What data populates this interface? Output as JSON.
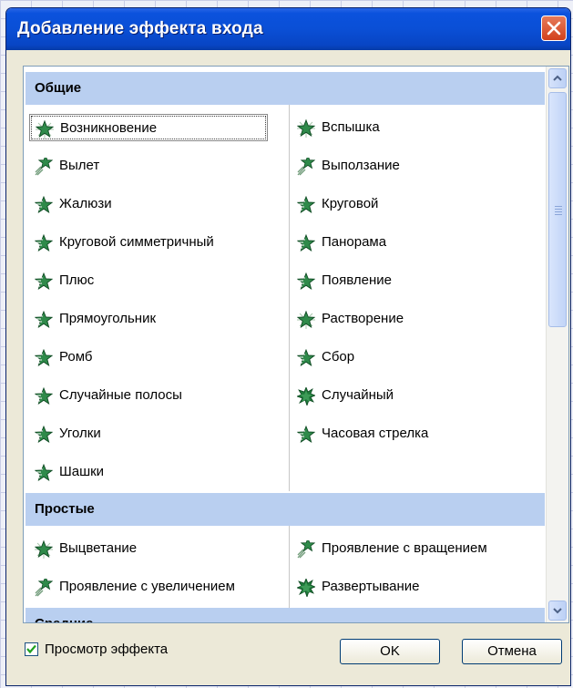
{
  "dialog": {
    "title": "Добавление эффекта входа",
    "close_label": "×"
  },
  "groups": [
    {
      "name": "Общие",
      "items_left": [
        {
          "label": "Возникновение",
          "icon": "star-burst-icon",
          "selected": true
        },
        {
          "label": "Вылет",
          "icon": "star-trail-icon"
        },
        {
          "label": "Жалюзи",
          "icon": "star-stripes-icon"
        },
        {
          "label": "Круговой симметричный",
          "icon": "star-stripes-icon"
        },
        {
          "label": "Плюс",
          "icon": "star-stripes-icon"
        },
        {
          "label": "Прямоугольник",
          "icon": "star-stripes-icon"
        },
        {
          "label": "Ромб",
          "icon": "star-stripes-icon"
        },
        {
          "label": "Случайные полосы",
          "icon": "star-stripes-icon"
        },
        {
          "label": "Уголки",
          "icon": "star-stripes-icon"
        },
        {
          "label": "Шашки",
          "icon": "star-stripes-icon"
        }
      ],
      "items_right": [
        {
          "label": "Вспышка",
          "icon": "star-burst-icon"
        },
        {
          "label": "Выползание",
          "icon": "star-trail-icon"
        },
        {
          "label": "Круговой",
          "icon": "star-stripes-icon"
        },
        {
          "label": "Панорама",
          "icon": "star-stripes-icon"
        },
        {
          "label": "Появление",
          "icon": "star-stripes-icon"
        },
        {
          "label": "Растворение",
          "icon": "star-burst-icon"
        },
        {
          "label": "Сбор",
          "icon": "star-stripes-icon"
        },
        {
          "label": "Случайный",
          "icon": "star-spiky-icon"
        },
        {
          "label": "Часовая стрелка",
          "icon": "star-stripes-icon"
        }
      ]
    },
    {
      "name": "Простые",
      "items_left": [
        {
          "label": "Выцветание",
          "icon": "star-burst-icon"
        },
        {
          "label": "Проявление с увеличением",
          "icon": "star-trail-icon"
        }
      ],
      "items_right": [
        {
          "label": "Проявление с вращением",
          "icon": "star-trail-icon"
        },
        {
          "label": "Развертывание",
          "icon": "star-spiky-icon"
        }
      ]
    },
    {
      "name": "Средние",
      "items_left": [],
      "items_right": []
    }
  ],
  "footer": {
    "preview_checkbox_label": "Просмотр эффекта",
    "preview_checkbox_checked": true,
    "ok_label": "OK",
    "cancel_label": "Отмена"
  },
  "colors": {
    "titlebar": "#0a4fd6",
    "group_header": "#b9cff0",
    "star_green": "#2f8a4a",
    "close_red": "#d2411c"
  }
}
